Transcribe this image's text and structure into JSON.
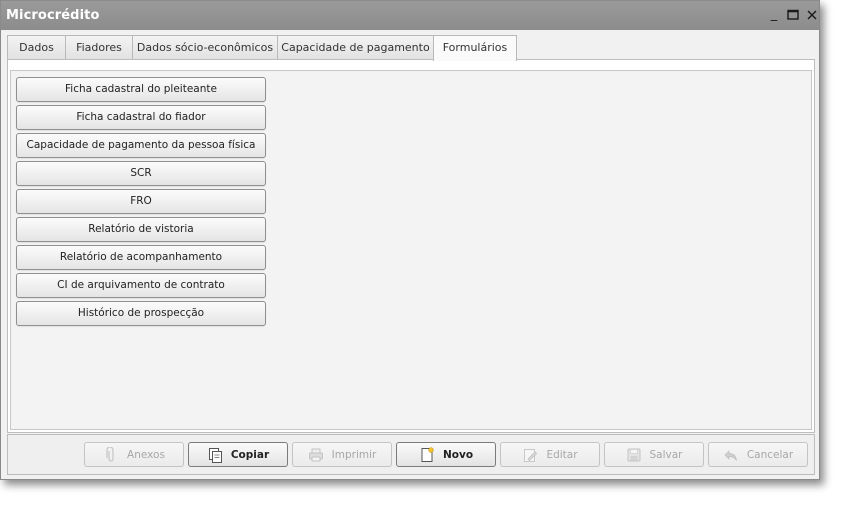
{
  "window": {
    "title": "Microcrédito",
    "controls": {
      "minimize": "_",
      "maximize": "□",
      "close": "✕"
    }
  },
  "tabs": [
    {
      "label": "Dados",
      "active": false
    },
    {
      "label": "Fiadores",
      "active": false
    },
    {
      "label": "Dados sócio-econômicos",
      "active": false
    },
    {
      "label": "Capacidade de pagamento",
      "active": false
    },
    {
      "label": "Formulários",
      "active": true
    }
  ],
  "forms": [
    "Ficha cadastral do pleiteante",
    "Ficha cadastral do fiador",
    "Capacidade de pagamento da pessoa física",
    "SCR",
    "FRO",
    "Relatório de vistoria",
    "Relatório de acompanhamento",
    "CI de arquivamento de contrato",
    "Histórico de prospecção"
  ],
  "toolbar": {
    "anexos": {
      "label": "Anexos",
      "icon": "paperclip-icon",
      "enabled": false
    },
    "copiar": {
      "label": "Copiar",
      "icon": "copy-icon",
      "enabled": true
    },
    "imprimir": {
      "label": "Imprimir",
      "icon": "printer-icon",
      "enabled": false
    },
    "novo": {
      "label": "Novo",
      "icon": "new-document-icon",
      "enabled": true
    },
    "editar": {
      "label": "Editar",
      "icon": "pencil-icon",
      "enabled": false
    },
    "salvar": {
      "label": "Salvar",
      "icon": "save-icon",
      "enabled": false
    },
    "cancelar": {
      "label": "Cancelar",
      "icon": "undo-icon",
      "enabled": false
    }
  },
  "colors": {
    "titlebar": "#919191",
    "window_bg": "#f1f1f1",
    "disabled_text": "#a7a7a7"
  }
}
